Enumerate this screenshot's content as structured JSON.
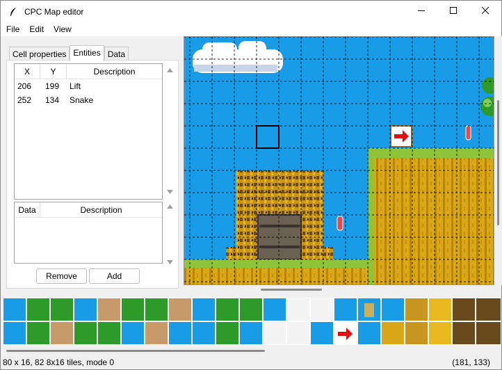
{
  "window": {
    "title": "CPC Map editor",
    "app_icon": "feather-icon",
    "controls": [
      "minimize-icon",
      "maximize-icon",
      "close-icon"
    ]
  },
  "menu": {
    "items": [
      {
        "label": "File"
      },
      {
        "label": "Edit"
      },
      {
        "label": "View"
      }
    ]
  },
  "tabs": {
    "items": [
      {
        "label": "Cell properties"
      },
      {
        "label": "Entities",
        "active": true
      },
      {
        "label": "Data"
      }
    ]
  },
  "entities": {
    "columns": {
      "x": "X",
      "y": "Y",
      "description": "Description"
    },
    "rows": [
      {
        "x": "206",
        "y": "199",
        "description": "Lift"
      },
      {
        "x": "252",
        "y": "134",
        "description": "Snake"
      }
    ]
  },
  "data_table": {
    "columns": {
      "data": "Data",
      "description": "Description"
    },
    "rows": []
  },
  "buttons": {
    "remove": "Remove",
    "add": "Add"
  },
  "status": {
    "info": "80 x 16, 82 8x16 tiles, mode 0",
    "coords": "(181, 133)"
  },
  "colors": {
    "sky": "#1a9be6",
    "grass": "#8fc43a",
    "dirt": "#d9a818",
    "trunk": "#6b4a1c",
    "tree_green": "#2e9a2a",
    "door": "#6a6054"
  }
}
